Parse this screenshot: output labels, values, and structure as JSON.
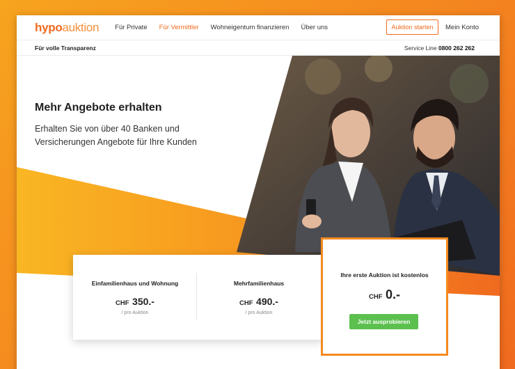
{
  "header": {
    "logo_part1": "hypo",
    "logo_part2": "auktion",
    "nav": [
      "Für Private",
      "Für Vermittler",
      "Wohneigentum finanzieren",
      "Über uns"
    ],
    "active_nav_index": 1,
    "start_button": "Auktion starten",
    "account_link": "Mein Konto"
  },
  "subheader": {
    "tagline": "Für volle Transparenz",
    "service_label": "Service Line",
    "service_number": "0800 262 262"
  },
  "hero": {
    "title": "Mehr Angebote erhalten",
    "subtitle": "Erhalten Sie von über 40 Banken und Versicherungen Angebote für Ihre Kunden"
  },
  "offers": [
    {
      "title": "Einfamilienhaus und Wohnung",
      "currency": "CHF",
      "amount": "350.-",
      "per": "/ pro Auktion"
    },
    {
      "title": "Mehrfamilienhaus",
      "currency": "CHF",
      "amount": "490.-",
      "per": "/ pro Auktion"
    }
  ],
  "free_offer": {
    "title": "Ihre erste Auktion ist kostenlos",
    "currency": "CHF",
    "amount": "0.-",
    "button": "Jetzt ausprobieren"
  },
  "colors": {
    "brand_orange": "#f06a1f",
    "accent_yellow": "#f7a41f",
    "button_green": "#5cc04f"
  }
}
